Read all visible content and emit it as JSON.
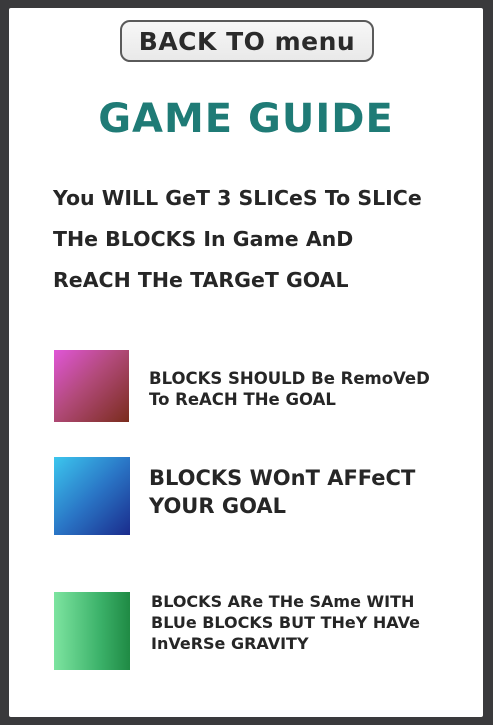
{
  "back_button": {
    "label": "BACK TO menu"
  },
  "title": "GAME GUIDE",
  "intro": {
    "line1": "You WILL GeT 3 SLICeS To SLICe",
    "line2": "THe BLOCKS In Game AnD",
    "line3": "ReACH THe TARGeT GOAL"
  },
  "legend": [
    {
      "color_name": "pink",
      "colors": [
        "#e056d8",
        "#b24a7a",
        "#7a2c1c"
      ],
      "line1": "BLOCKS SHOULD Be RemoVeD",
      "line2": "To ReACH THe GOAL"
    },
    {
      "color_name": "blue",
      "colors": [
        "#3cc6ee",
        "#2a76c6",
        "#1a2b8c"
      ],
      "line1": "BLOCKS WOnT AFFeCT",
      "line2": "YOUR GOAL"
    },
    {
      "color_name": "green",
      "colors": [
        "#7de4a0",
        "#3cb26a",
        "#1f8a44"
      ],
      "line1": "BLOCKS ARe THe SAme WITH",
      "line2": "BLUe BLOCKS BUT THeY HAVe",
      "line3": "InVeRSe GRAVITY"
    }
  ],
  "colors": {
    "title": "#1f7b76",
    "text": "#262626",
    "frame": "#3a3a3c",
    "panel": "#ffffff"
  }
}
